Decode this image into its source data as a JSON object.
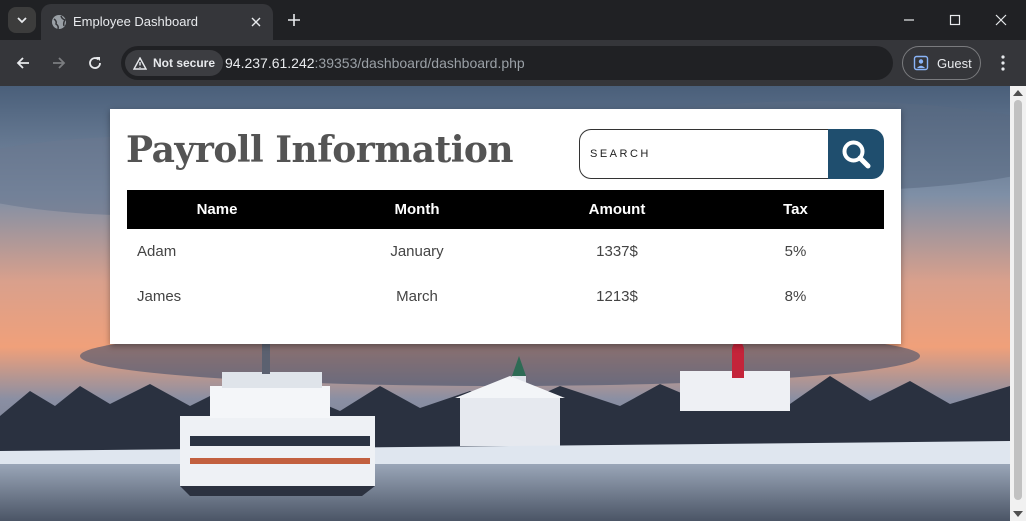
{
  "browser": {
    "tab_title": "Employee Dashboard",
    "security_label": "Not secure",
    "url_host": "94.237.61.242",
    "url_rest": ":39353/dashboard/dashboard.php",
    "profile_label": "Guest"
  },
  "page": {
    "title": "Payroll Information",
    "search": {
      "placeholder": "SEARCH",
      "value": ""
    },
    "table": {
      "headers": [
        "Name",
        "Month",
        "Amount",
        "Tax"
      ],
      "rows": [
        [
          "Adam",
          "January",
          "1337$",
          "5%"
        ],
        [
          "James",
          "March",
          "1213$",
          "8%"
        ]
      ]
    }
  },
  "colors": {
    "search_button": "#1f4e6e",
    "table_header_bg": "#000000",
    "title_text": "#545454"
  },
  "icons": {
    "tab_menu": "chevron-down-icon",
    "favicon": "globe-icon",
    "tab_close": "close-icon",
    "new_tab": "plus-icon",
    "minimize": "minimize-icon",
    "maximize": "maximize-icon",
    "window_close": "close-icon",
    "back": "back-arrow-icon",
    "forward": "forward-arrow-icon",
    "reload": "reload-icon",
    "warning": "warning-icon",
    "profile": "profile-icon",
    "menu": "kebab-menu-icon",
    "search": "search-icon"
  }
}
